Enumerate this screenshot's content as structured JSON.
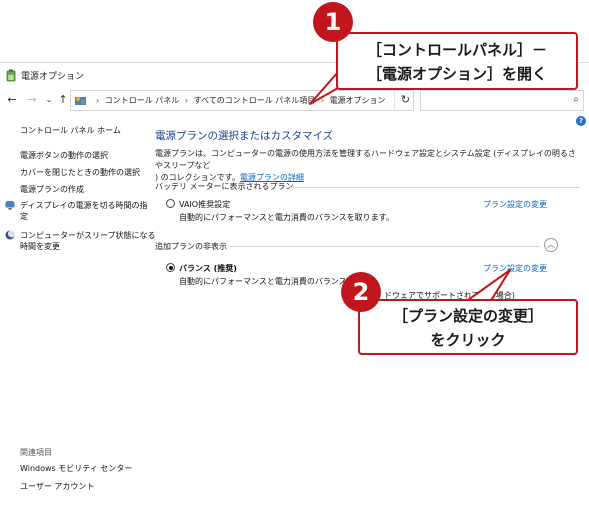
{
  "window": {
    "title": "電源オプション"
  },
  "addressbar": {
    "crumbs": [
      "コントロール パネル",
      "すべてのコントロール パネル項目",
      "電源オプション"
    ],
    "search_placeholder": ""
  },
  "sidebar": {
    "home": "コントロール パネル ホーム",
    "links": [
      "電源ボタンの動作の選択",
      "カバーを閉じたときの動作の選択",
      "電源プランの作成"
    ],
    "icon_links": [
      {
        "line1": "ディスプレイの電源を切る時間の指",
        "line2": "定"
      },
      {
        "line1": "コンピューターがスリープ状態になる",
        "line2": "時間を変更"
      }
    ],
    "related_heading": "関連項目",
    "related": [
      "Windows モビリティ センター",
      "ユーザー アカウント"
    ]
  },
  "main": {
    "title": "電源プランの選択またはカスタマイズ",
    "desc_line1": "電源プランは、コンピューターの電源の使用方法を管理するハードウェア設定とシステム設定 (ディスプレイの明るさやスリープなど",
    "desc_line2_prefix": ") のコレクションです。",
    "desc_link": "電源プランの詳細",
    "battery_group": "バッテリ メーターに表示されるプラン",
    "additional_group": "追加プランの非表示",
    "plans": [
      {
        "name": "VAIO推奨設定",
        "desc": "自動的にパフォーマンスと電力消費のバランスを取ります。",
        "link": "プラン設定の変更",
        "selected": false
      },
      {
        "name": "バランス (推奨)",
        "desc": "自動的にパフォーマンスと電力消費のバランスを取り",
        "desc_tail": "ドウェアでサポートされている場合)",
        "link": "プラン設定の変更",
        "selected": true
      }
    ]
  },
  "callouts": {
    "c1": {
      "number": "1",
      "line1": "［コントロールパネル］－",
      "line2": "［電源オプション］を開く"
    },
    "c2": {
      "number": "2",
      "line1": "［プラン設定の変更］",
      "line2": "をクリック"
    }
  },
  "colors": {
    "accent_red": "#c0161c",
    "link_blue": "#0066cc",
    "title_blue": "#1b3f94"
  }
}
